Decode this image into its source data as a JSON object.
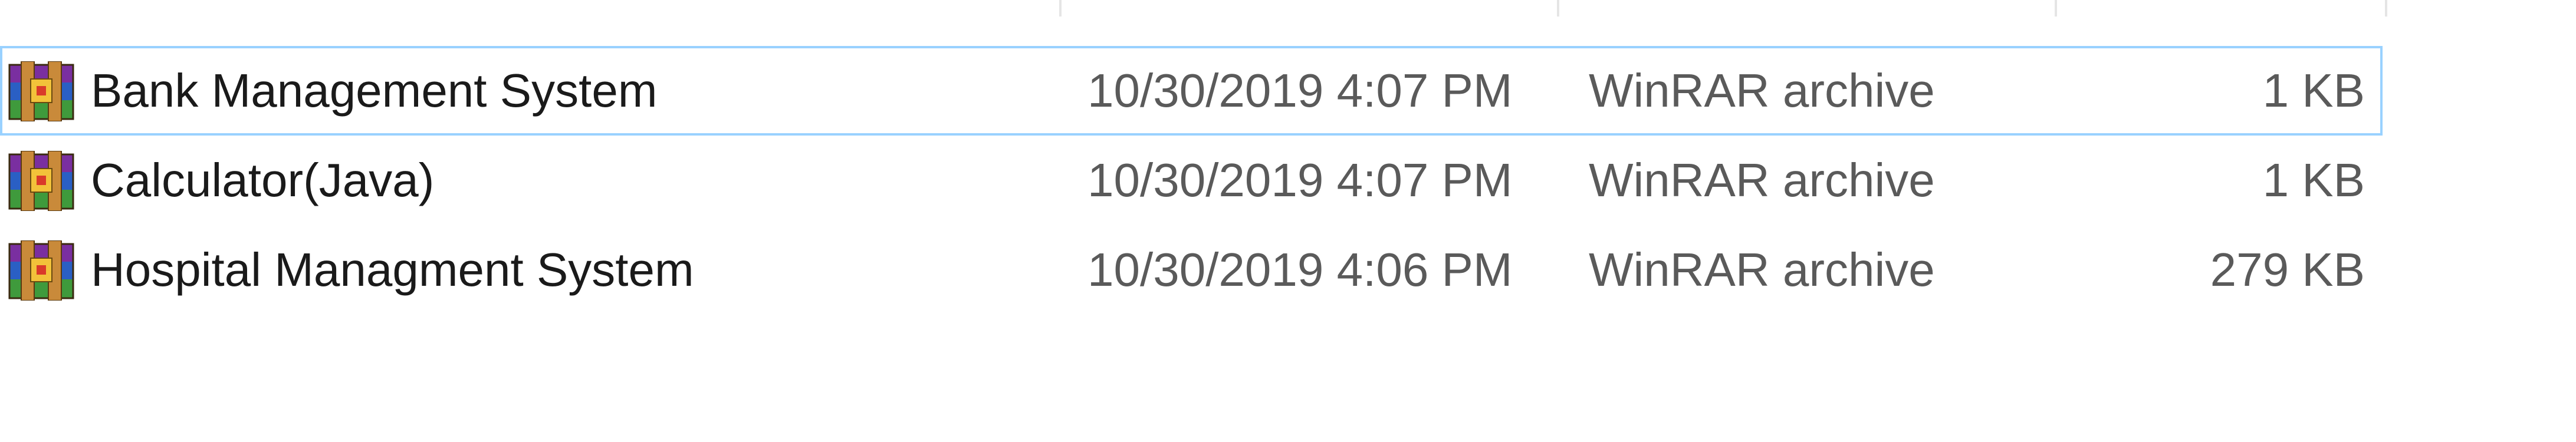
{
  "file_list": {
    "rows": [
      {
        "name": "Bank Management System",
        "date_modified": "10/30/2019 4:07 PM",
        "type": "WinRAR archive",
        "size": "1 KB",
        "selected": true,
        "icon": "winrar-archive-icon"
      },
      {
        "name": "Calculator(Java)",
        "date_modified": "10/30/2019 4:07 PM",
        "type": "WinRAR archive",
        "size": "1 KB",
        "selected": false,
        "icon": "winrar-archive-icon"
      },
      {
        "name": "Hospital Managment System",
        "date_modified": "10/30/2019 4:06 PM",
        "type": "WinRAR archive",
        "size": "279 KB",
        "selected": false,
        "icon": "winrar-archive-icon"
      }
    ]
  },
  "colors": {
    "selection_border": "#99d1ff",
    "name_text": "#1a1a1a",
    "detail_text": "#5a5a5a",
    "column_divider": "#e5e5e5"
  }
}
